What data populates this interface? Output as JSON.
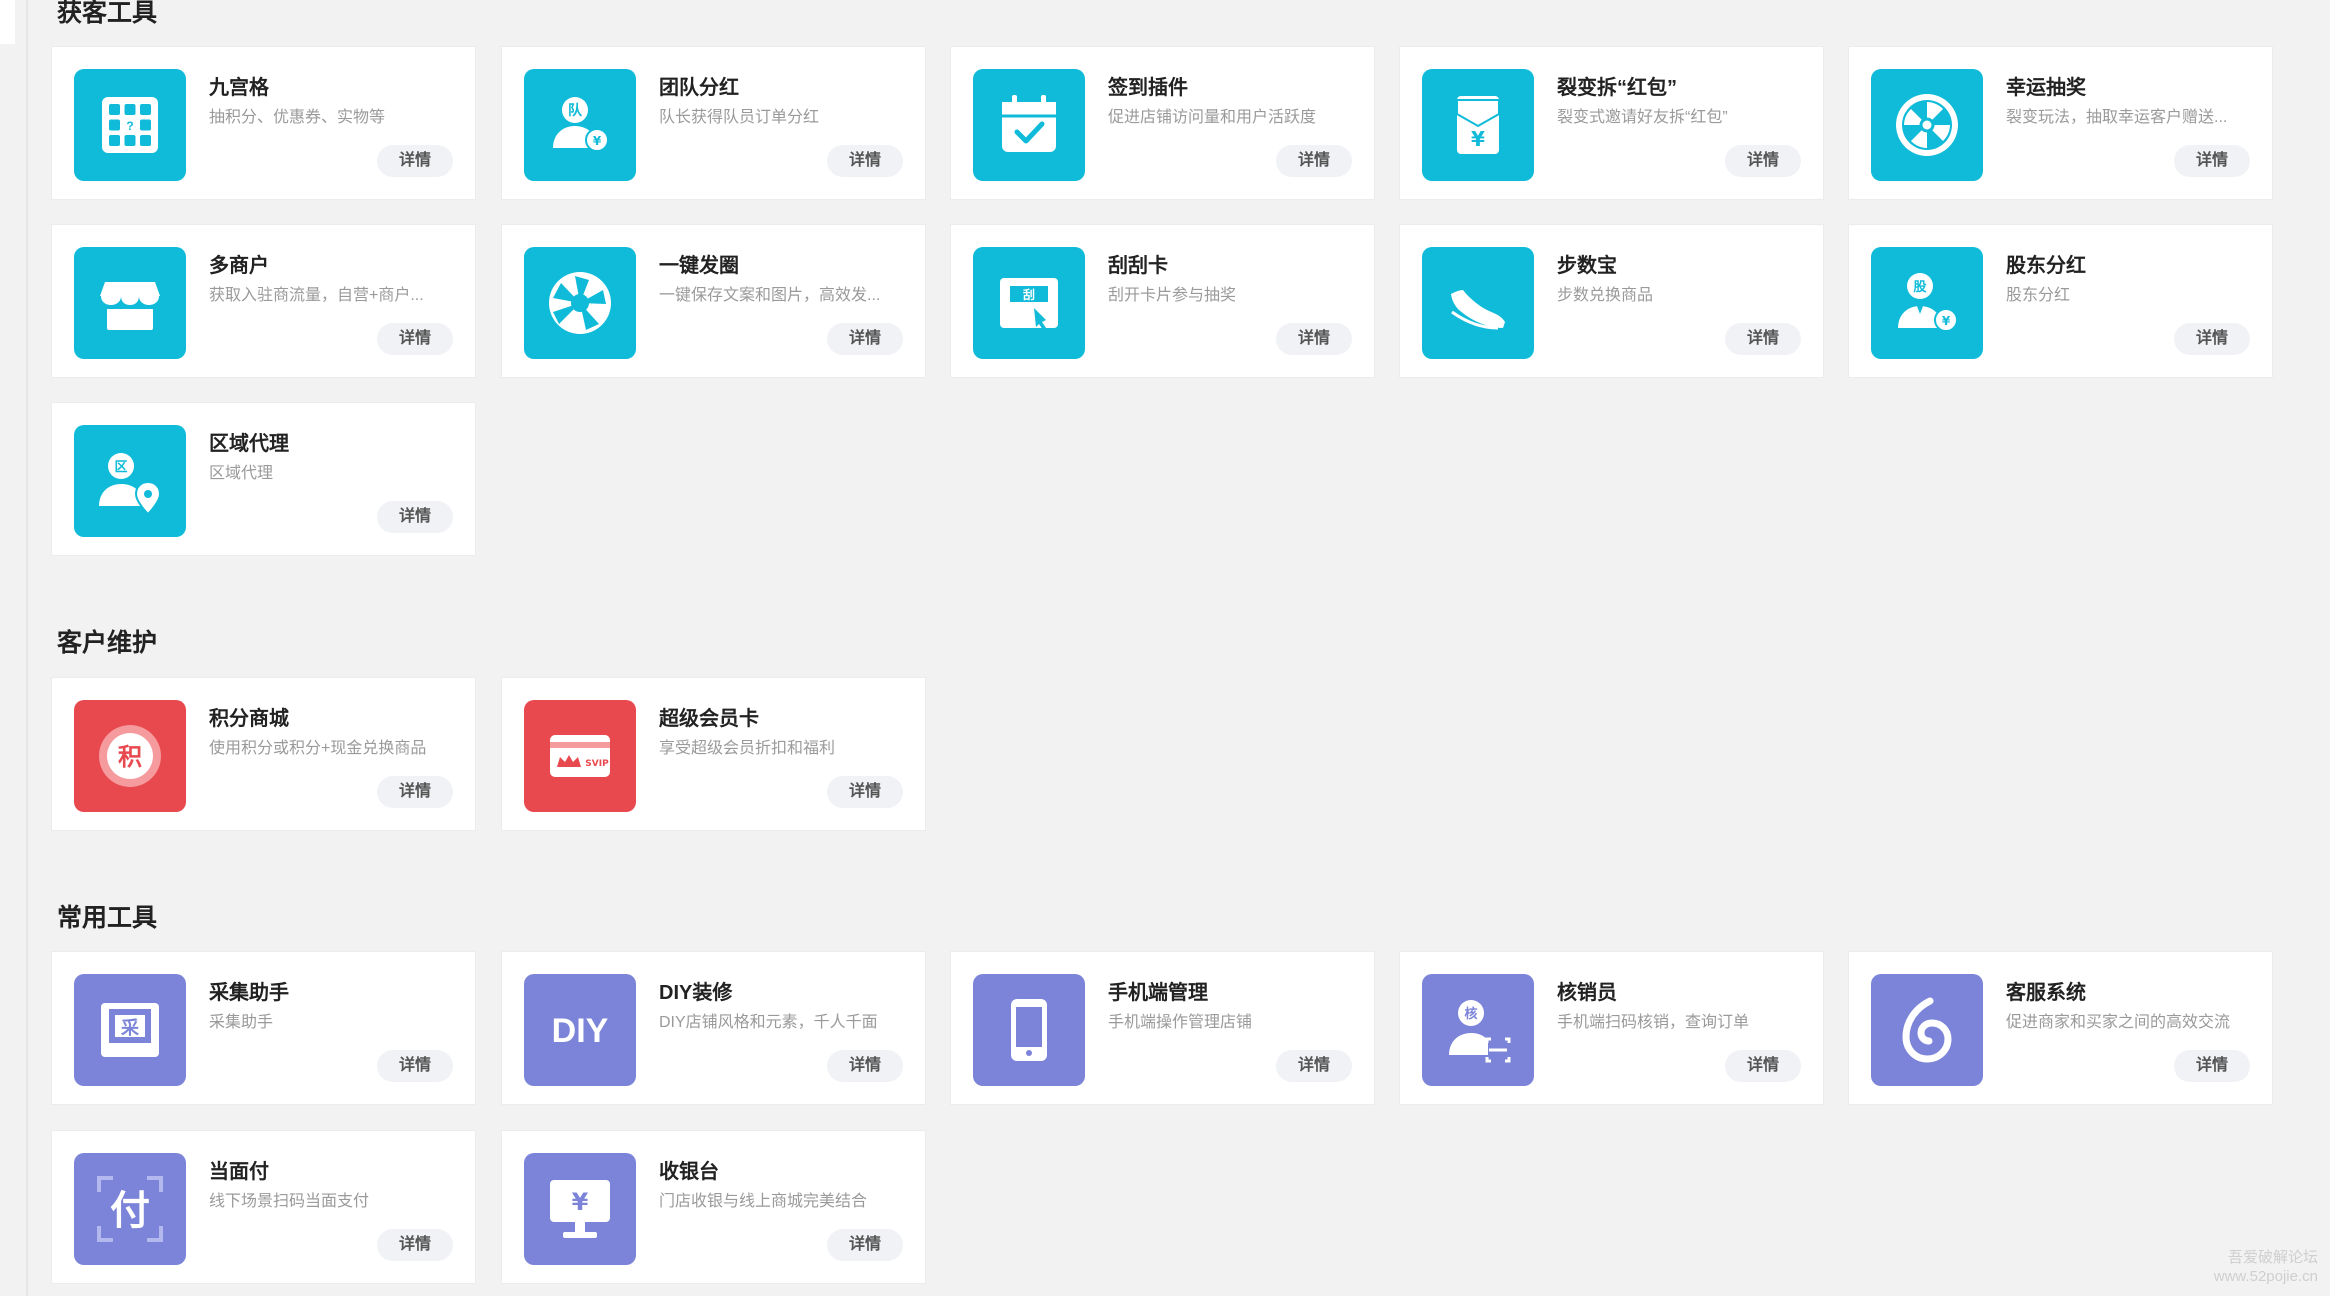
{
  "sections": [
    {
      "title": "获客工具",
      "items": [
        {
          "name": "九宫格",
          "desc": "抽积分、优惠券、实物等",
          "icon": "nine-grid-icon",
          "color": "#0fbbd8"
        },
        {
          "name": "团队分红",
          "desc": "队长获得队员订单分红",
          "icon": "team-dividend-icon",
          "color": "#0fbbd8"
        },
        {
          "name": "签到插件",
          "desc": "促进店铺访问量和用户活跃度",
          "icon": "calendar-check-icon",
          "color": "#0fbbd8"
        },
        {
          "name": "裂变拆“红包”",
          "desc": "裂变式邀请好友拆“红包”",
          "icon": "red-packet-icon",
          "color": "#0fbbd8"
        },
        {
          "name": "幸运抽奖",
          "desc": "裂变玩法，抽取幸运客户赠送...",
          "icon": "lucky-wheel-icon",
          "color": "#0fbbd8"
        },
        {
          "name": "多商户",
          "desc": "获取入驻商流量，自营+商户...",
          "icon": "shop-icon",
          "color": "#0fbbd8"
        },
        {
          "name": "一键发圈",
          "desc": "一键保存文案和图片，高效发...",
          "icon": "aperture-icon",
          "color": "#0fbbd8"
        },
        {
          "name": "刮刮卡",
          "desc": "刮开卡片参与抽奖",
          "icon": "scratch-card-icon",
          "color": "#0fbbd8"
        },
        {
          "name": "步数宝",
          "desc": "步数兑换商品",
          "icon": "sneaker-icon",
          "color": "#0fbbd8"
        },
        {
          "name": "股东分红",
          "desc": "股东分红",
          "icon": "shareholder-icon",
          "color": "#0fbbd8"
        },
        {
          "name": "区域代理",
          "desc": "区域代理",
          "icon": "region-agent-icon",
          "color": "#0fbbd8"
        }
      ]
    },
    {
      "title": "客户维护",
      "items": [
        {
          "name": "积分商城",
          "desc": "使用积分或积分+现金兑换商品",
          "icon": "points-mall-icon",
          "color": "#e8494f"
        },
        {
          "name": "超级会员卡",
          "desc": "享受超级会员折扣和福利",
          "icon": "svip-card-icon",
          "color": "#e8494f"
        }
      ]
    },
    {
      "title": "常用工具",
      "items": [
        {
          "name": "采集助手",
          "desc": "采集助手",
          "icon": "collect-icon",
          "color": "#7b84d8"
        },
        {
          "name": "DIY装修",
          "desc": "DIY店铺风格和元素，千人千面",
          "icon": "diy-icon",
          "color": "#7b84d8"
        },
        {
          "name": "手机端管理",
          "desc": "手机端操作管理店铺",
          "icon": "mobile-icon",
          "color": "#7b84d8"
        },
        {
          "name": "核销员",
          "desc": "手机端扫码核销，查询订单",
          "icon": "verifier-icon",
          "color": "#7b84d8"
        },
        {
          "name": "客服系统",
          "desc": "促进商家和买家之间的高效交流",
          "icon": "customer-service-icon",
          "color": "#7b84d8"
        },
        {
          "name": "当面付",
          "desc": "线下场景扫码当面支付",
          "icon": "face-pay-icon",
          "color": "#7b84d8"
        },
        {
          "name": "收银台",
          "desc": "门店收银与线上商城完美结合",
          "icon": "cashier-icon",
          "color": "#7b84d8"
        }
      ]
    }
  ],
  "detail_label": "详情",
  "icon_text": {
    "team": "队",
    "yen": "¥",
    "scratch": "刮",
    "shareholder": "股",
    "region": "区",
    "points": "积",
    "svip": "SVIP",
    "collect": "采",
    "diy": "DIY",
    "verify": "核",
    "pay": "付"
  },
  "watermark": [
    "吾爱破解论坛",
    "www.52pojie.cn"
  ]
}
